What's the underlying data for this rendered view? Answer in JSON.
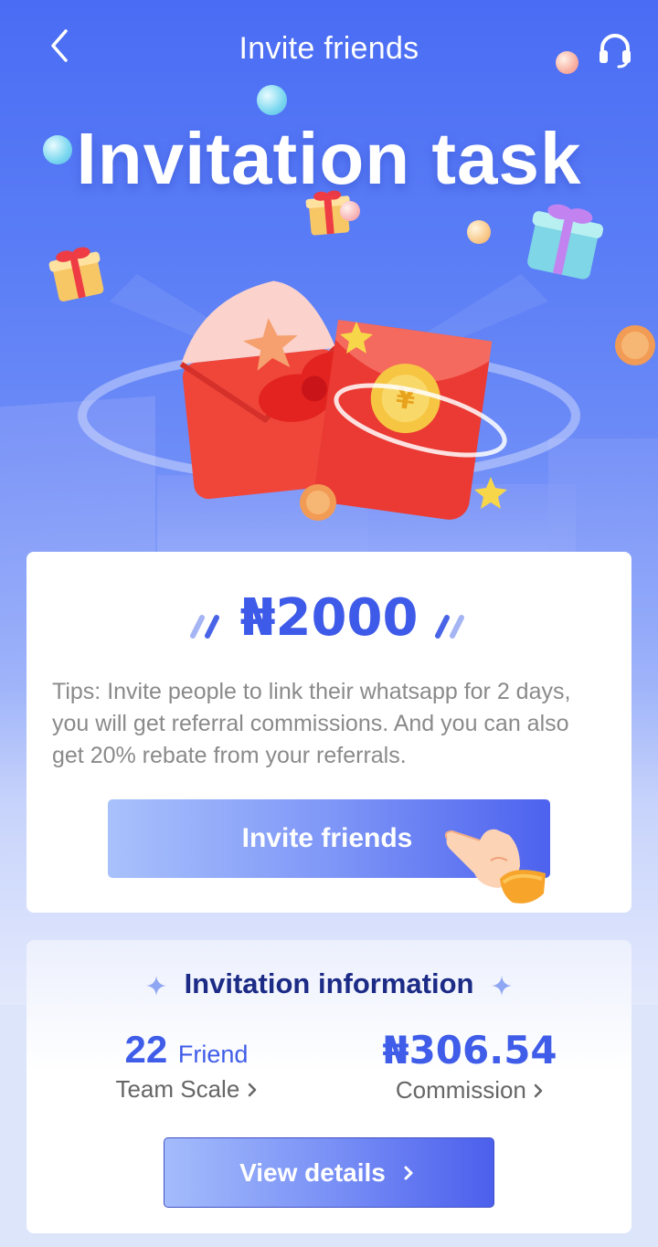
{
  "header": {
    "title": "Invite friends",
    "back_icon": "chevron-left-icon",
    "support_icon": "headset-icon"
  },
  "hero": {
    "title": "Invitation task"
  },
  "reward_card": {
    "amount": "₦2000",
    "tips": "Tips: Invite people to link their whatsapp for 2 days, you will get referral commissions. And you can also get 20% rebate from your referrals.",
    "button_label": "Invite friends"
  },
  "info_card": {
    "title": "Invitation information",
    "team_count": "22",
    "team_unit": "Friend",
    "team_label": "Team Scale",
    "commission_value": "₦306.54",
    "commission_label": "Commission",
    "view_button_label": "View details"
  },
  "colors": {
    "accent": "#3f5de8",
    "hero_top": "#4a6cf4",
    "info_title": "#1c2b86"
  }
}
